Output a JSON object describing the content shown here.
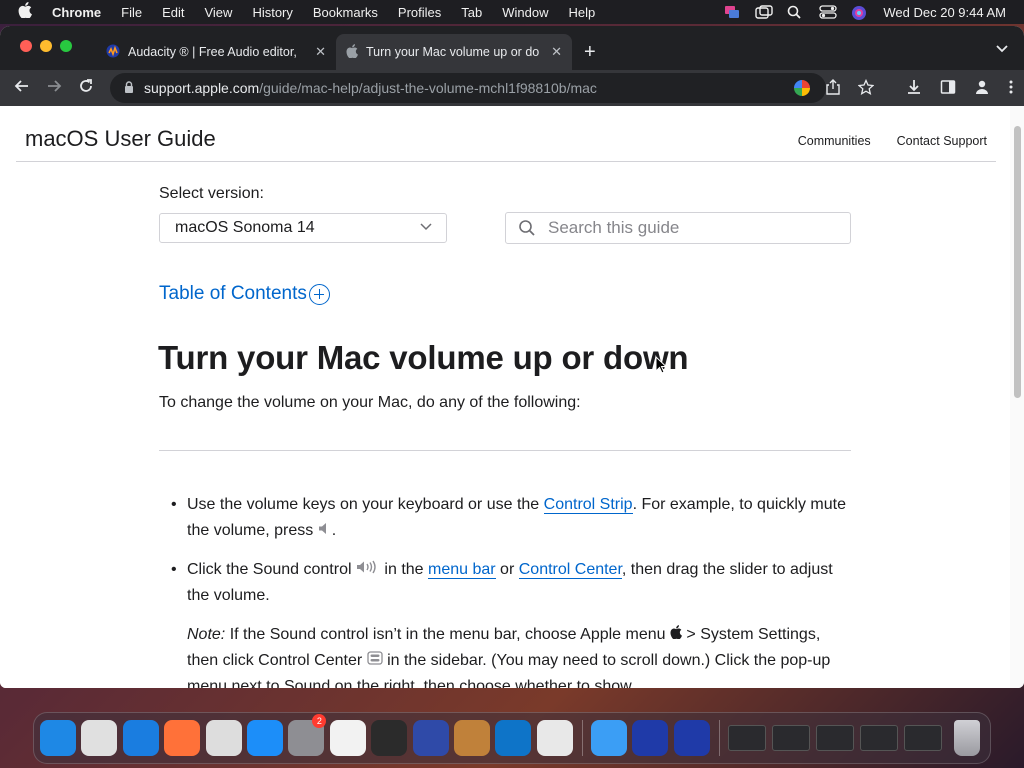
{
  "menubar": {
    "app_name": "Chrome",
    "items": [
      "File",
      "Edit",
      "View",
      "History",
      "Bookmarks",
      "Profiles",
      "Tab",
      "Window",
      "Help"
    ],
    "datetime": "Wed Dec 20  9:44 AM"
  },
  "browser": {
    "tabs": [
      {
        "title": "Audacity ® | Free Audio editor,",
        "active": false
      },
      {
        "title": "Turn your Mac volume up or do",
        "active": true
      }
    ],
    "url_host": "support.apple.com",
    "url_path": "/guide/mac-help/adjust-the-volume-mchl1f98810b/mac"
  },
  "page": {
    "guide_title": "macOS User Guide",
    "header_links": [
      "Communities",
      "Contact Support"
    ],
    "select_label": "Select version:",
    "selected_version": "macOS Sonoma 14",
    "search_placeholder": "Search this guide",
    "toc_label": "Table of Contents",
    "article_title": "Turn your Mac volume up or down",
    "intro": "To change the volume on your Mac, do any of the following:",
    "step1": {
      "text_a": "Use the volume keys on your keyboard or use the ",
      "link": "Control Strip",
      "text_b": ". For example, to quickly mute the volume, press ",
      "text_c": "."
    },
    "step2": {
      "text_a": "Click the Sound control ",
      "text_b": " in the ",
      "link1": "menu bar",
      "text_c": " or ",
      "link2": "Control Center",
      "text_d": ", then drag the slider to adjust the volume."
    },
    "note": {
      "label": "Note:",
      "text_a": " If the Sound control isn’t in the menu bar, choose Apple menu ",
      "text_b": " > System Settings, then click Control Center ",
      "text_c": " in the sidebar. (You may need to scroll down.) Click the pop-up menu next to Sound on the right, then choose whether to show"
    }
  },
  "dock": {
    "apps": [
      "finder",
      "launchpad",
      "safari",
      "firefox",
      "chrome",
      "app-store",
      "system-settings",
      "script-editor",
      "terminal",
      "instruments",
      "garageband",
      "vscode",
      "parallels",
      "weather",
      "audacity",
      "audacity-2"
    ],
    "settings_badge": "2",
    "colors": [
      "#1e88e5",
      "#e0e0e0",
      "#1a7de0",
      "#ff7139",
      "#dddddd",
      "#1c8ef9",
      "#8e8e93",
      "#f2f2f2",
      "#2b2b2b",
      "#2f4aa8",
      "#c0813a",
      "#0e74c8",
      "#e8e8e8",
      "#3b9ef5",
      "#1f3aa8",
      "#1f3aa8"
    ]
  }
}
